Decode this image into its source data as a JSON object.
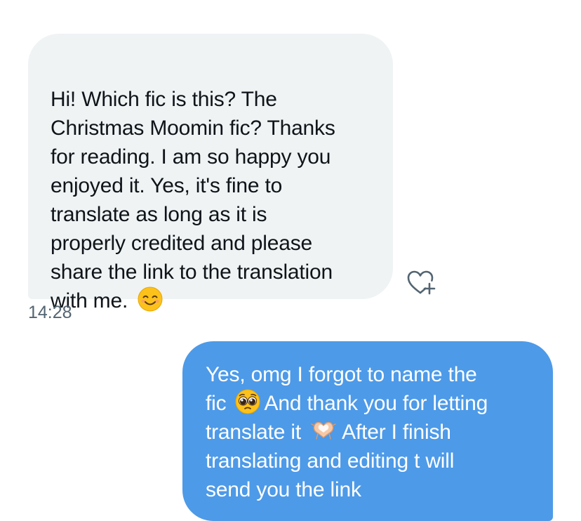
{
  "incoming_message": {
    "lines": [
      "Hi! Which fic is this? The",
      "Christmas Moomin fic? Thanks",
      "for reading. I am so happy you",
      "enjoyed it. Yes, it's fine to",
      "translate as long as it is",
      "properly credited and please",
      "share the link to the translation",
      "with me."
    ],
    "emoji": "smiling-face-emoji",
    "timestamp": "14:28"
  },
  "reaction_button": {
    "icon": "heart-plus-icon"
  },
  "outgoing_message": {
    "line1": "Yes, omg I forgot to name the",
    "line2_a": "fic",
    "line2_b": "And thank you for letting",
    "line3_a": "translate it",
    "line3_b": "After I finish",
    "line4": "translating and editing t will",
    "line5": "send you the link",
    "emoji_1": "pleading-face-emoji",
    "emoji_2": "heart-hands-emoji"
  },
  "colors": {
    "incoming_bubble": "#eff3f4",
    "outgoing_bubble": "#4d9ae8",
    "timestamp": "#536471"
  }
}
